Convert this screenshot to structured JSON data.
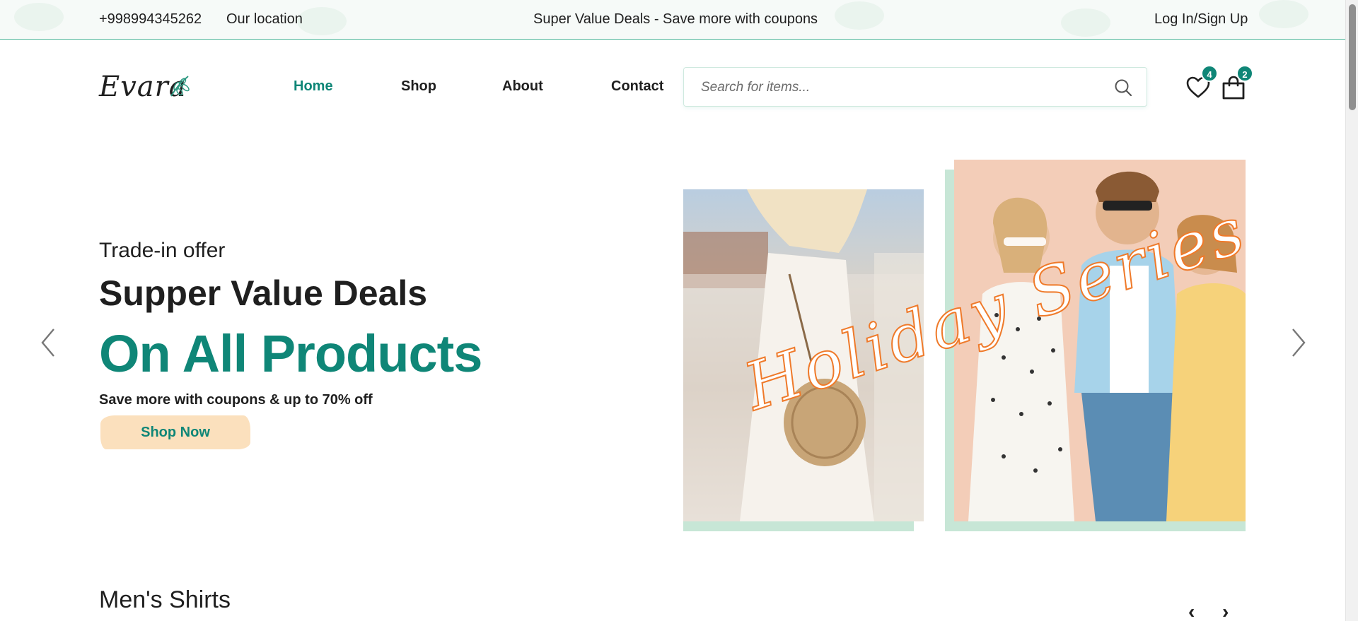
{
  "topbar": {
    "phone": "+998994345262",
    "location": "Our location",
    "promo": "Super Value Deals - Save more with coupons",
    "login": "Log In/Sign Up"
  },
  "header": {
    "logo": "Evara",
    "nav": [
      "Home",
      "Shop",
      "About",
      "Contact"
    ],
    "active_nav": "Home",
    "search": {
      "placeholder": "Search for items...",
      "value": ""
    },
    "wishlist_count": "4",
    "cart_count": "2"
  },
  "hero": {
    "subtitle": "Trade-in offer",
    "title": "Supper Value Deals",
    "main": "On All Products",
    "description": "Save more with coupons & up to 70% off",
    "button": "Shop Now",
    "overlay_text": "Holiday Series"
  },
  "section": {
    "title": "Men's Shirts",
    "prev": "‹",
    "next": "›"
  },
  "colors": {
    "accent": "#0f8677",
    "button_bg": "#fbe0bd",
    "image_frame": "#c7e6d6",
    "overlay_script": "#ef7a2a"
  },
  "icons": [
    "search-icon",
    "heart-icon",
    "shopping-bag-icon",
    "chevron-left-icon",
    "chevron-right-icon",
    "leaf-icon"
  ]
}
